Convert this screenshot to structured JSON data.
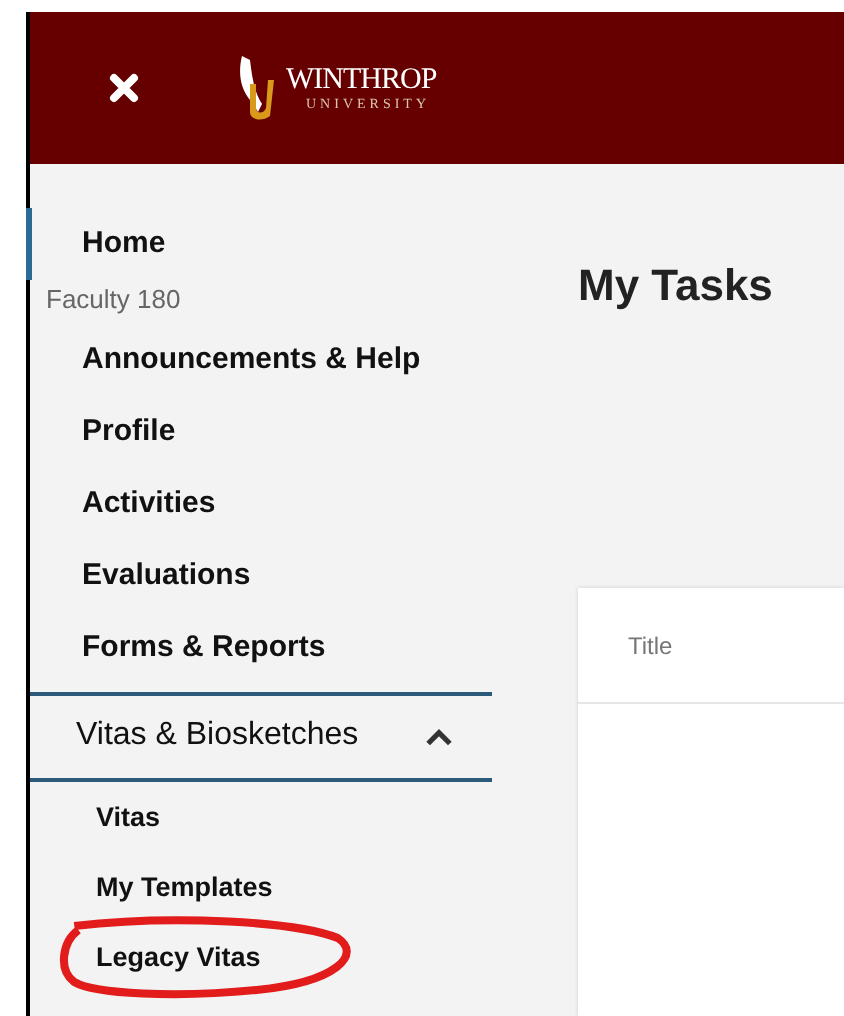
{
  "header": {
    "logo": {
      "name": "WINTHROP",
      "subtitle": "UNIVERSITY"
    }
  },
  "sidebar": {
    "items": [
      {
        "kind": "link",
        "label": "Home",
        "selected": true
      },
      {
        "kind": "section",
        "label": "Faculty 180"
      },
      {
        "kind": "link",
        "label": "Announcements & Help",
        "selected": false
      },
      {
        "kind": "link",
        "label": "Profile",
        "selected": false
      },
      {
        "kind": "link",
        "label": "Activities",
        "selected": false
      },
      {
        "kind": "link",
        "label": "Evaluations",
        "selected": false
      },
      {
        "kind": "link",
        "label": "Forms & Reports",
        "selected": false
      },
      {
        "kind": "group",
        "label": "Vitas & Biosketches",
        "expanded": true,
        "children": [
          {
            "label": "Vitas",
            "circled": false
          },
          {
            "label": "My Templates",
            "circled": false
          },
          {
            "label": "Legacy Vitas",
            "circled": true
          }
        ]
      }
    ]
  },
  "main": {
    "title": "My Tasks",
    "table": {
      "columns": [
        "Title"
      ]
    }
  }
}
